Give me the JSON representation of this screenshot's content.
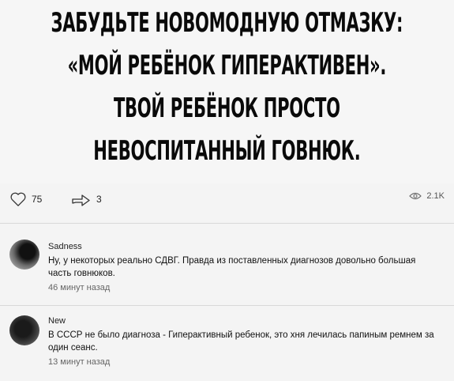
{
  "meme": {
    "lines": [
      "ЗАБУДЬТЕ НОВОМОДНУЮ ОТМАЗКУ:",
      "«МОЙ РЕБЁНОК ГИПЕРАКТИВЕН».",
      "ТВОЙ РЕБЁНОК ПРОСТО",
      "НЕВОСПИТАННЫЙ ГОВНЮК."
    ]
  },
  "actions": {
    "likes": "75",
    "shares": "3",
    "views": "2.1K"
  },
  "comments": [
    {
      "author": "Sadness",
      "text": "Ну, у некоторых реально СДВГ. Правда из поставленных диагнозов довольно большая часть говнюков.",
      "time": "46 минут назад"
    },
    {
      "author": "New",
      "text": "В СССР не было диагноза - Гиперактивный ребенок, это хня лечилась папиным ремнем за один сеанс.",
      "time": "13 минут назад"
    }
  ]
}
